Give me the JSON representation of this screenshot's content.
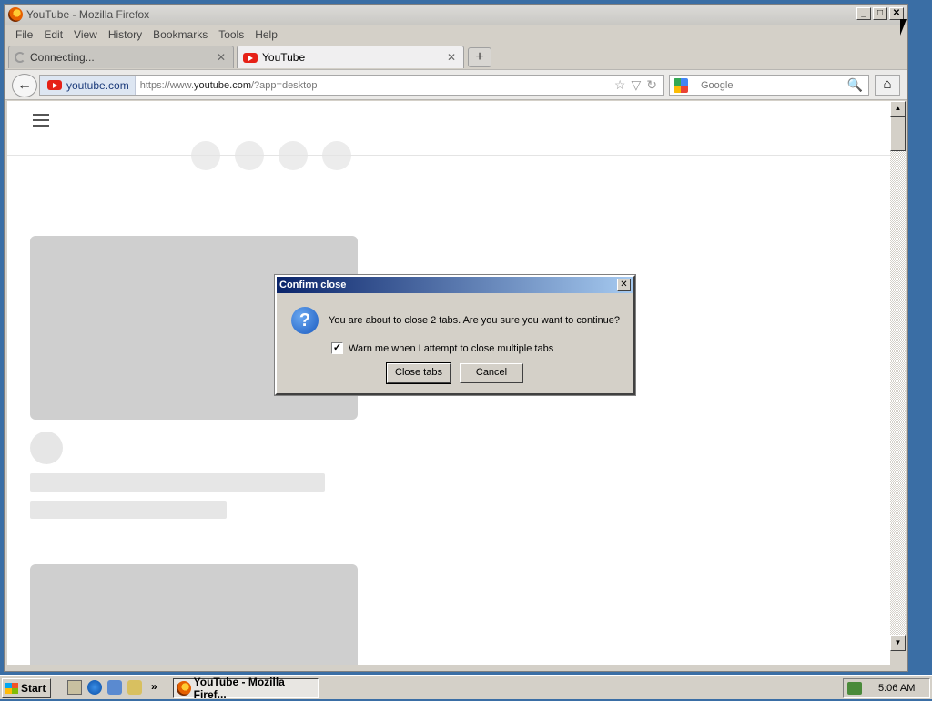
{
  "window": {
    "title": "YouTube - Mozilla Firefox",
    "minimize": "_",
    "maximize": "□",
    "close": "✕"
  },
  "menu": [
    "File",
    "Edit",
    "View",
    "History",
    "Bookmarks",
    "Tools",
    "Help"
  ],
  "tabs": [
    {
      "label": "Connecting...",
      "state": "loading",
      "close": "✕"
    },
    {
      "label": "YouTube",
      "state": "active",
      "close": "✕"
    }
  ],
  "new_tab": "+",
  "nav": {
    "back": "←",
    "site_identity": "youtube.com",
    "url_prefix": "https://www.",
    "url_domain": "youtube.com",
    "url_rest": "/?app=desktop",
    "bookmark_star": "☆",
    "dropdown": "▽",
    "reload": "↻",
    "search_placeholder": "Google",
    "search_go": "🔍",
    "home": "⌂"
  },
  "scrollbar": {
    "up": "▲",
    "down": "▼"
  },
  "dialog": {
    "title": "Confirm close",
    "close": "✕",
    "icon": "?",
    "message": "You are about to close 2 tabs. Are you sure you want to continue?",
    "checkbox_label": "Warn me when I attempt to close multiple tabs",
    "checkbox_checked": true,
    "checkbox_mark": "✓",
    "primary_button": "Close tabs",
    "secondary_button": "Cancel"
  },
  "taskbar": {
    "start": "Start",
    "more": "»",
    "task_label": "YouTube - Mozilla Firef...",
    "clock": "5:06 AM"
  },
  "colors": {
    "dialog_title_start": "#0a246a",
    "dialog_title_end": "#a6caf0",
    "youtube_red": "#e62117",
    "desktop": "#3a6ea5"
  }
}
